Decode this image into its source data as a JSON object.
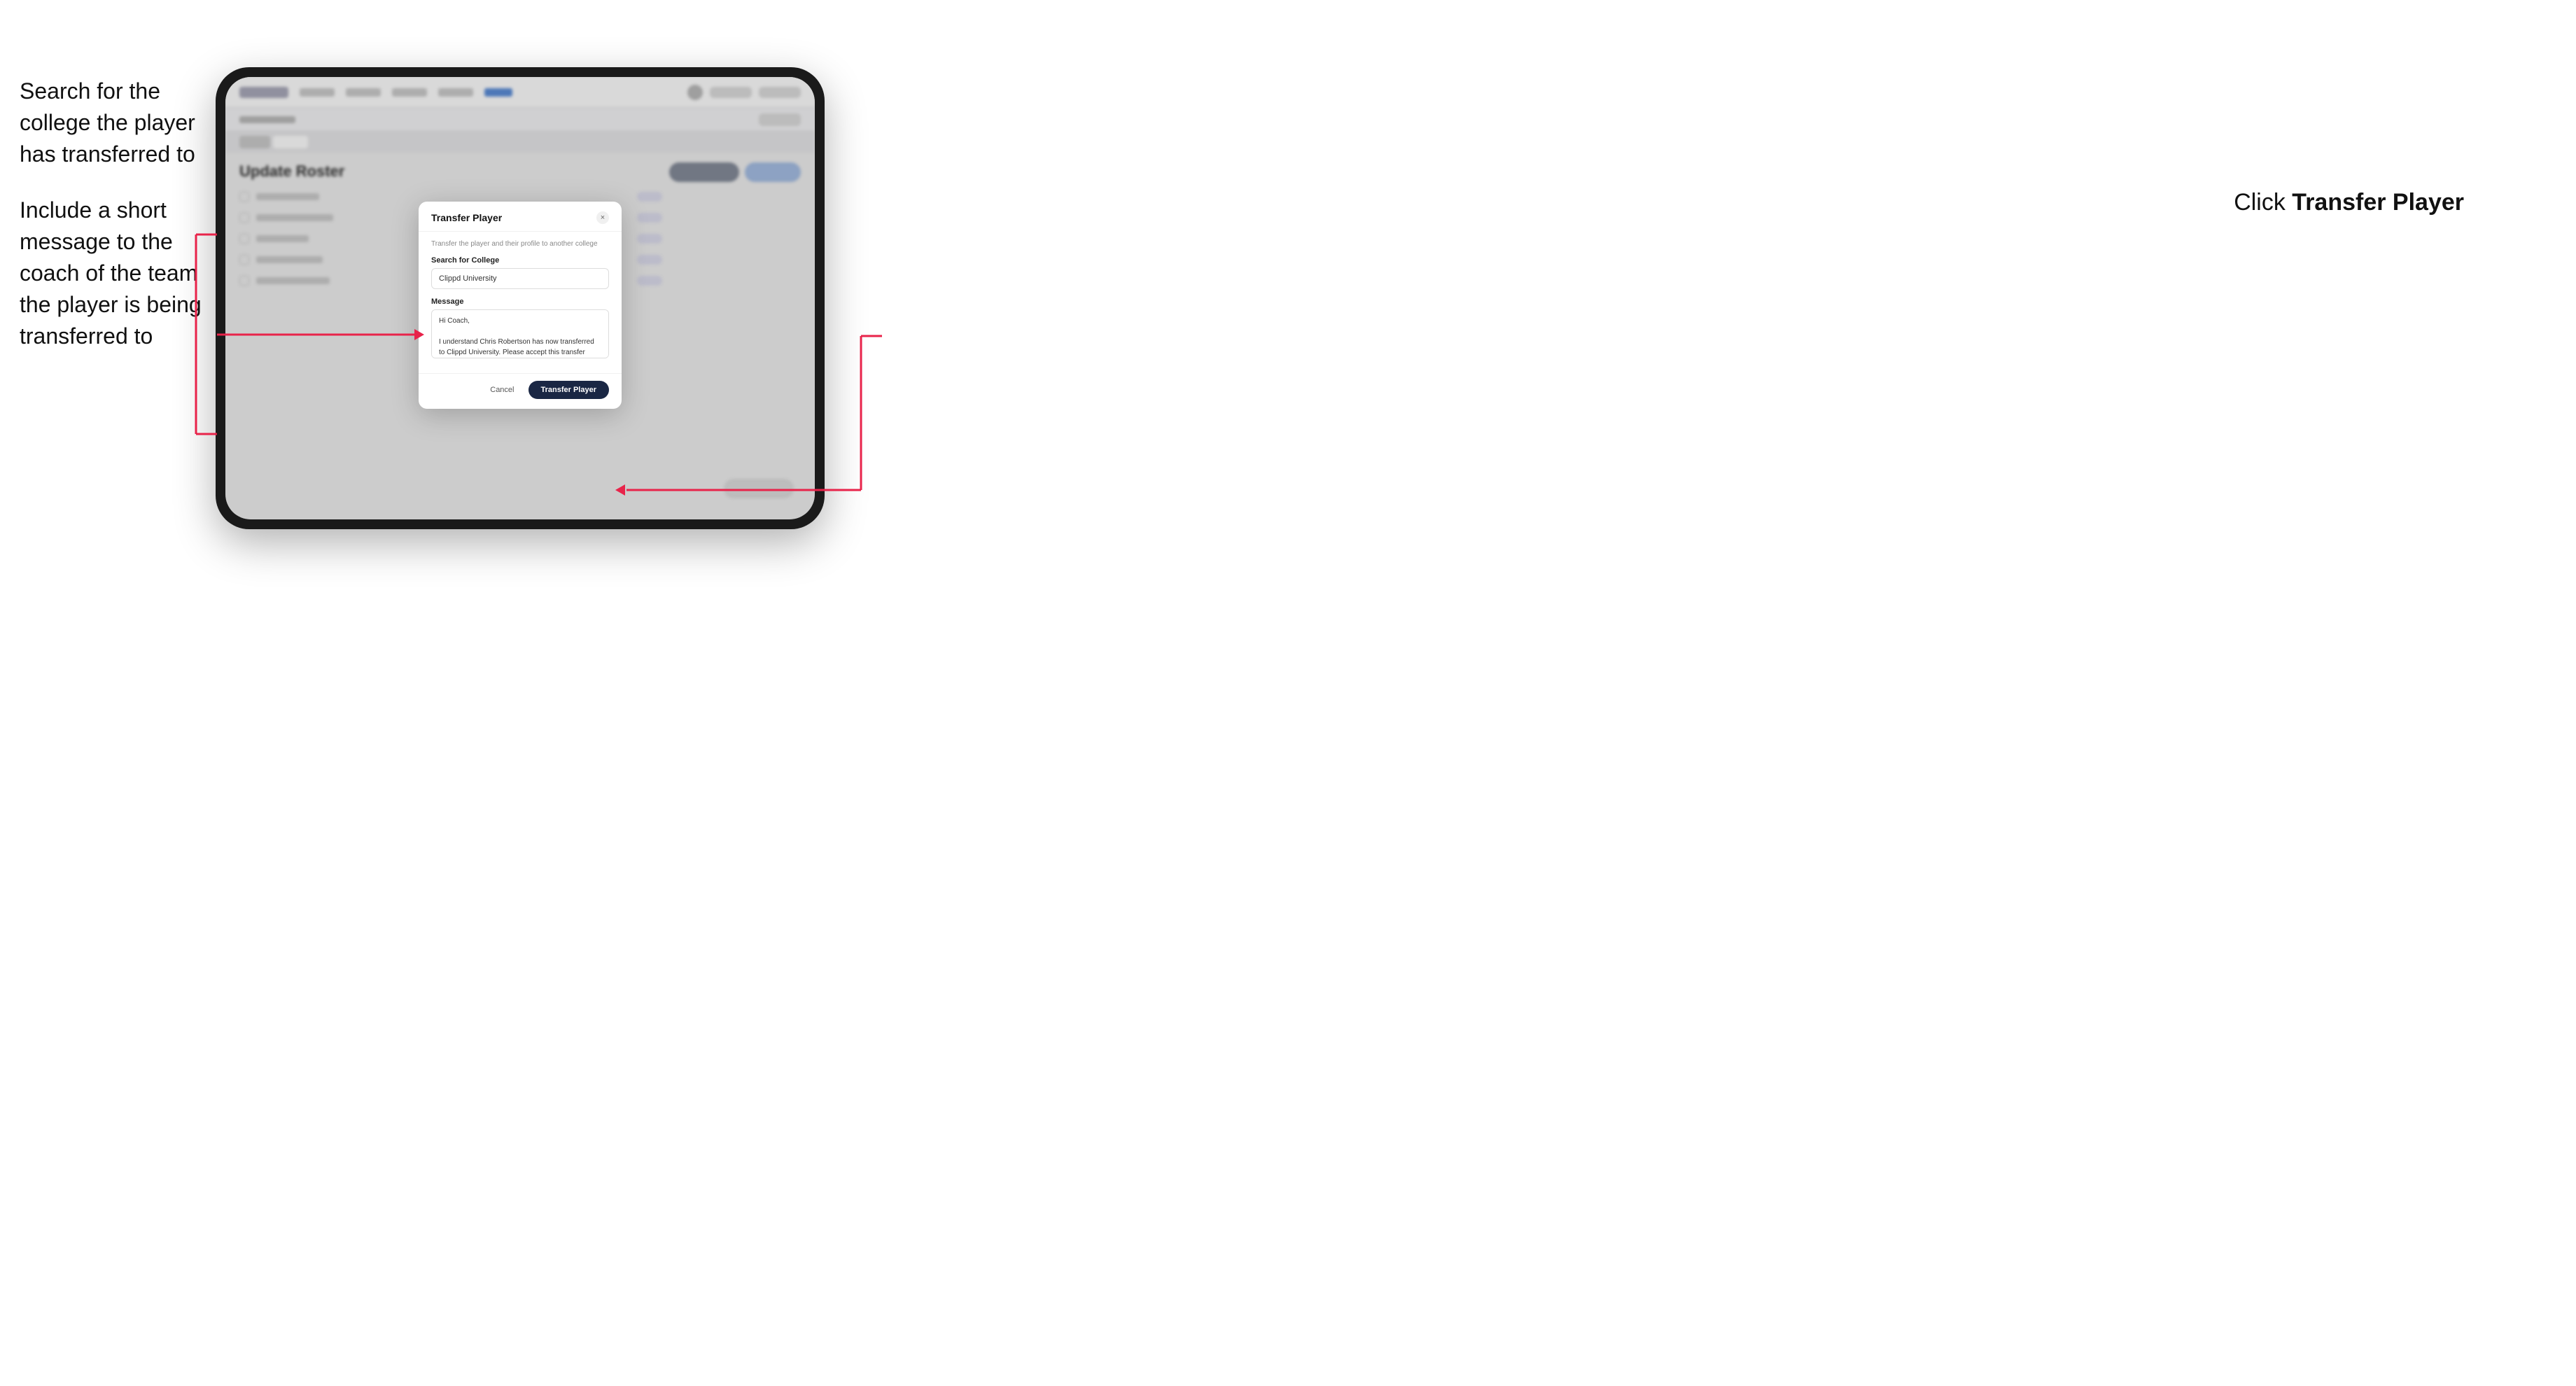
{
  "annotations": {
    "left_text_1": "Search for the college the player has transferred to",
    "left_text_2": "Include a short message to the coach of the team the player is being transferred to",
    "right_text_prefix": "Click ",
    "right_text_bold": "Transfer Player"
  },
  "modal": {
    "title": "Transfer Player",
    "close_label": "×",
    "subtitle": "Transfer the player and their profile to another college",
    "search_label": "Search for College",
    "search_value": "Clippd University",
    "search_placeholder": "Search for College",
    "message_label": "Message",
    "message_value": "Hi Coach,\n\nI understand Chris Robertson has now transferred to Clippd University. Please accept this transfer request when you can.",
    "cancel_label": "Cancel",
    "transfer_label": "Transfer Player"
  },
  "tablet": {
    "nav_logo": "",
    "page_title": "Update Roster"
  }
}
